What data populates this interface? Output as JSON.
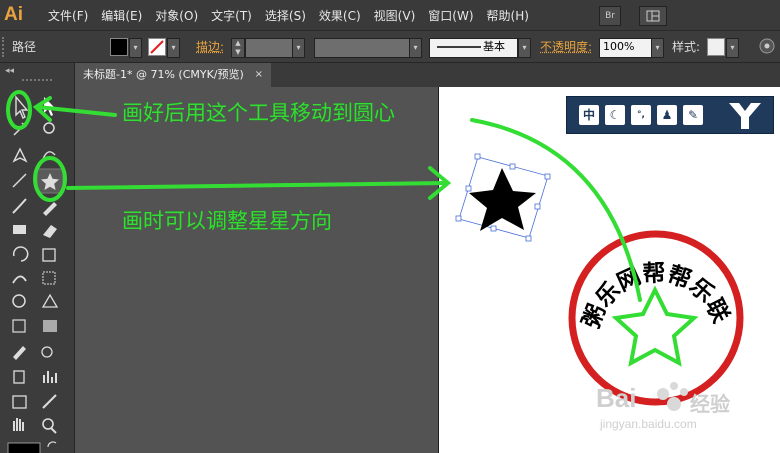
{
  "app": {
    "logo": "Ai"
  },
  "menubar": {
    "items": [
      {
        "label": "文件",
        "key": "F"
      },
      {
        "label": "编辑",
        "key": "E"
      },
      {
        "label": "对象",
        "key": "O"
      },
      {
        "label": "文字",
        "key": "T"
      },
      {
        "label": "选择",
        "key": "S"
      },
      {
        "label": "效果",
        "key": "C"
      },
      {
        "label": "视图",
        "key": "V"
      },
      {
        "label": "窗口",
        "key": "W"
      },
      {
        "label": "帮助",
        "key": "H"
      }
    ],
    "bridge_label": "Br"
  },
  "controlbar": {
    "object_type": "路径",
    "stroke_label": "描边:",
    "brush_value": "基本",
    "opacity_label": "不透明度:",
    "opacity_value": "100%",
    "style_label": "样式:"
  },
  "document": {
    "tab_title": "未标题-1* @ 71% (CMYK/预览)",
    "tab_close": "×"
  },
  "annotations": {
    "selection_tip": "画好后用这个工具移动到圆心",
    "star_tip": "画时可以调整星星方向"
  },
  "seal": {
    "text": "粥乐网帮帮乐联盟",
    "ring_color": "#d42020"
  },
  "badge": {
    "icons": [
      "中",
      "moon-icon",
      "dots-icon",
      "user-icon",
      "wrench-icon",
      "logo-icon"
    ]
  },
  "watermark": {
    "brand": "Bai",
    "brand_suffix": "经验",
    "url": "jingyan.baidu.com"
  },
  "colors": {
    "accent": "#e8a33d",
    "annotation": "#33dd33"
  }
}
